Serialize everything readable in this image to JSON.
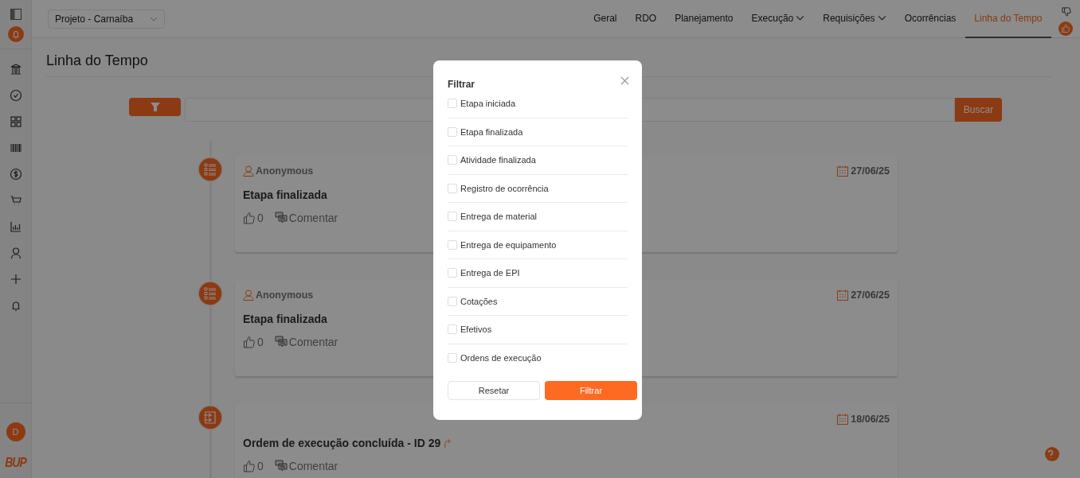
{
  "sidebar": {
    "avatar": "D",
    "logo": "BUP"
  },
  "project_select": {
    "value": "Projeto - Carnaíba"
  },
  "nav": [
    {
      "label": "Geral",
      "selected": false,
      "dropdown": false
    },
    {
      "label": "RDO",
      "selected": false,
      "dropdown": false
    },
    {
      "label": "Planejamento",
      "selected": false,
      "dropdown": false
    },
    {
      "label": "Execução",
      "selected": false,
      "dropdown": true
    },
    {
      "label": "Requisições",
      "selected": false,
      "dropdown": true
    },
    {
      "label": "Ocorrências",
      "selected": false,
      "dropdown": false
    },
    {
      "label": "Linha do Tempo",
      "selected": true,
      "dropdown": false
    }
  ],
  "page_title": "Linha do Tempo",
  "search": {
    "button": "Buscar"
  },
  "timeline": [
    {
      "kind": "stage",
      "author": "Anonymous",
      "date": "27/06/25",
      "title": "Etapa finalizada",
      "link": false,
      "likes": "0",
      "comment": "Comentar"
    },
    {
      "kind": "stage",
      "author": "Anonymous",
      "date": "27/06/25",
      "title": "Etapa finalizada",
      "link": false,
      "likes": "0",
      "comment": "Comentar"
    },
    {
      "kind": "order",
      "date": "18/06/25",
      "title": "Ordem de execução concluída - ID 29",
      "link": true,
      "likes": "0",
      "comment": "Comentar"
    }
  ],
  "filter_dialog": {
    "title": "Filtrar",
    "options": [
      {
        "label": "Etapa iniciada",
        "checked": false
      },
      {
        "label": "Etapa finalizada",
        "checked": false
      },
      {
        "label": "Atividade finalizada",
        "checked": false
      },
      {
        "label": "Registro de ocorrência",
        "checked": false
      },
      {
        "label": "Entrega de material",
        "checked": false
      },
      {
        "label": "Entrega de equipamento",
        "checked": false
      },
      {
        "label": "Entrega de EPI",
        "checked": false
      },
      {
        "label": "Cotações",
        "checked": false
      },
      {
        "label": "Efetivos",
        "checked": false
      },
      {
        "label": "Ordens de execução",
        "checked": false
      }
    ],
    "reset_button": "Resetar",
    "apply_button": "Filtrar"
  }
}
